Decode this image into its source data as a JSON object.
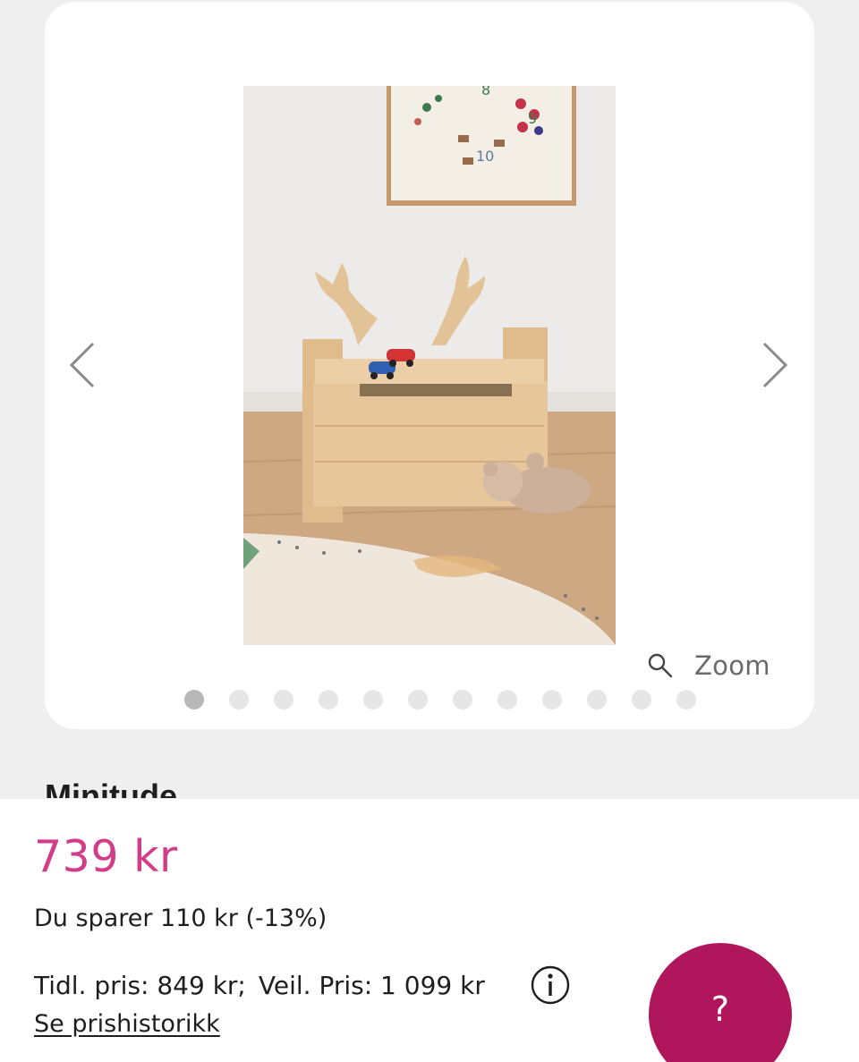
{
  "gallery": {
    "zoom_label": "Zoom",
    "dot_count": 12,
    "active_index": 0,
    "image_alt": "Wooden toy chest with antlers"
  },
  "product": {
    "brand_partial": "Minitude",
    "price": "739 kr",
    "savings": "Du sparer 110 kr (-13%)",
    "prev_price": "Tidl. pris: 849 kr;",
    "rec_price": "Veil. Pris: 1 099 kr",
    "history_link": "Se prishistorikk"
  },
  "help": {
    "label": "?"
  },
  "colors": {
    "price": "#d23d8a",
    "help_button": "#b0165c",
    "card": "#ffffff",
    "page_bg": "#efefef"
  },
  "icons": [
    "chevron-left-icon",
    "chevron-right-icon",
    "magnifier-icon",
    "info-icon"
  ]
}
